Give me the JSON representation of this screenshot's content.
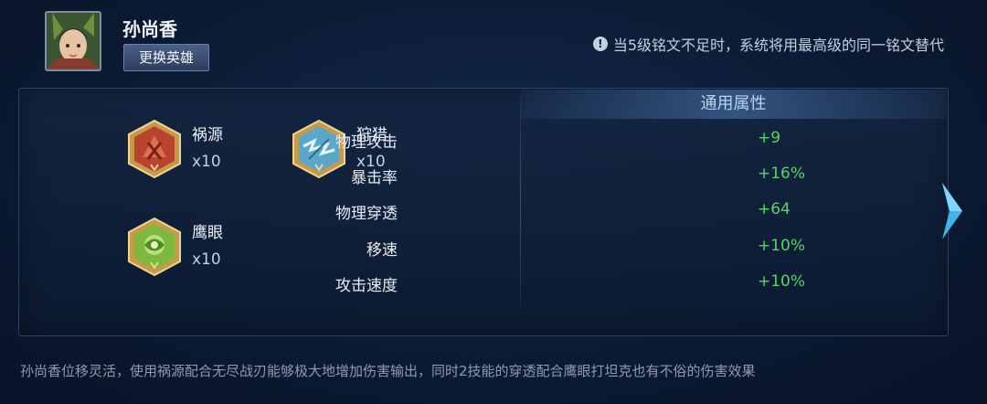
{
  "hero": {
    "name": "孙尚香",
    "change_button": "更换英雄"
  },
  "notice": {
    "icon": "exclamation-info-icon",
    "text": "当5级铭文不足时，系统将用最高级的同一铭文替代"
  },
  "runes": [
    {
      "name": "祸源",
      "count": "x10",
      "color": "#c2503a"
    },
    {
      "name": "狩猎",
      "count": "x10",
      "color": "#5aa7c9"
    },
    {
      "name": "鹰眼",
      "count": "x10",
      "color": "#7db83f"
    }
  ],
  "attributes": {
    "title": "通用属性",
    "rows": [
      {
        "label": "物理攻击",
        "value": "+9"
      },
      {
        "label": "暴击率",
        "value": "+16%"
      },
      {
        "label": "物理穿透",
        "value": "+64"
      },
      {
        "label": "移速",
        "value": "+10%"
      },
      {
        "label": "攻击速度",
        "value": "+10%"
      }
    ]
  },
  "footer_text": "孙尚香位移灵活，使用祸源配合无尽战刃能够极大地增加伤害输出，同时2技能的穿透配合鹰眼打坦克也有不俗的伤害效果",
  "colors": {
    "value_green": "#58d36a",
    "accent_blue": "#3fb5f0"
  }
}
